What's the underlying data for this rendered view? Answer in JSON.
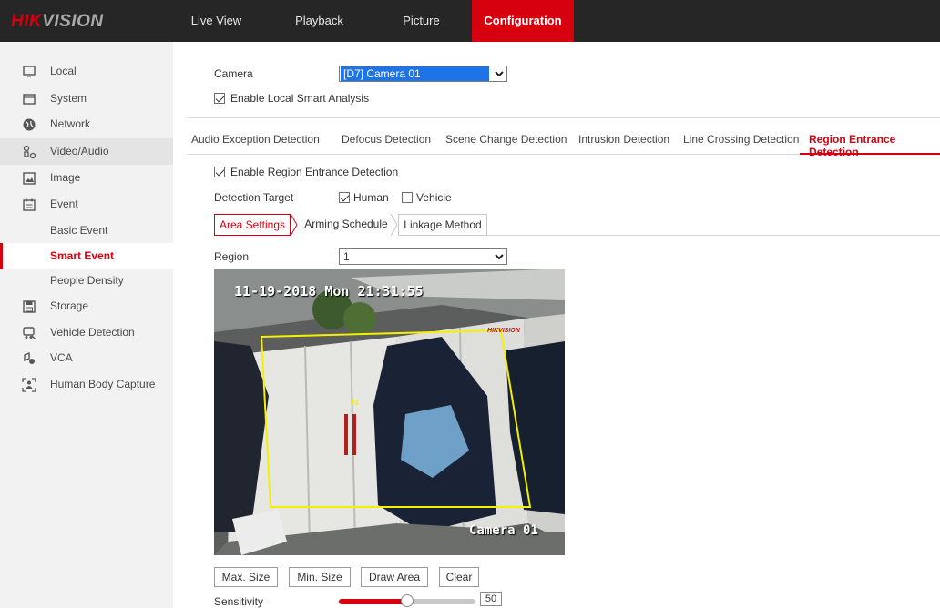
{
  "brand": {
    "logo_red": "HIK",
    "logo_gray": "VISION"
  },
  "topnav": [
    {
      "label": "Live View",
      "active": false
    },
    {
      "label": "Playback",
      "active": false
    },
    {
      "label": "Picture",
      "active": false
    },
    {
      "label": "Configuration",
      "active": true
    }
  ],
  "sidebar": {
    "items": [
      {
        "label": "Local",
        "icon": "monitor-icon"
      },
      {
        "label": "System",
        "icon": "system-icon"
      },
      {
        "label": "Network",
        "icon": "globe-icon"
      },
      {
        "label": "Video/Audio",
        "icon": "video-audio-icon"
      },
      {
        "label": "Image",
        "icon": "image-icon"
      },
      {
        "label": "Event",
        "icon": "calendar-icon"
      },
      {
        "label": "Basic Event"
      },
      {
        "label": "Smart Event",
        "active": true
      },
      {
        "label": "People Density"
      },
      {
        "label": "Storage",
        "icon": "storage-icon"
      },
      {
        "label": "Vehicle Detection",
        "icon": "vehicle-icon"
      },
      {
        "label": "VCA",
        "icon": "vca-icon"
      },
      {
        "label": "Human Body Capture",
        "icon": "human-body-icon"
      }
    ]
  },
  "camera": {
    "label": "Camera",
    "value": "[D7] Camera 01"
  },
  "local_smart": {
    "label": "Enable Local Smart Analysis",
    "checked": true
  },
  "detection_tabs": [
    {
      "label": "Audio Exception Detection"
    },
    {
      "label": "Defocus Detection"
    },
    {
      "label": "Scene Change Detection"
    },
    {
      "label": "Intrusion Detection"
    },
    {
      "label": "Line Crossing Detection"
    },
    {
      "label": "Region Entrance Detection",
      "active": true
    }
  ],
  "enable_region": {
    "label": "Enable Region Entrance Detection",
    "checked": true
  },
  "detection_target": {
    "label": "Detection Target",
    "human": {
      "label": "Human",
      "checked": true
    },
    "vehicle": {
      "label": "Vehicle",
      "checked": false
    }
  },
  "sub_tabs": [
    {
      "label": "Area Settings",
      "active": true
    },
    {
      "label": "Arming Schedule"
    },
    {
      "label": "Linkage Method"
    }
  ],
  "region": {
    "label": "Region",
    "value": "1"
  },
  "video": {
    "osd_time": "11-19-2018 Mon 21:31:55",
    "osd_camera": "Camera 01",
    "region_marker": "#1",
    "brand_text": "HIKVISION"
  },
  "buttons": {
    "max_size": "Max. Size",
    "min_size": "Min. Size",
    "draw_area": "Draw Area",
    "clear": "Clear"
  },
  "sensitivity": {
    "label": "Sensitivity",
    "value": "50",
    "level": 0.5
  },
  "colors": {
    "accent": "#d7000f",
    "topbar": "#262626",
    "sidebar": "#f2f2f2",
    "region_line": "#f5f000",
    "select_highlight": "#1e73e8"
  }
}
